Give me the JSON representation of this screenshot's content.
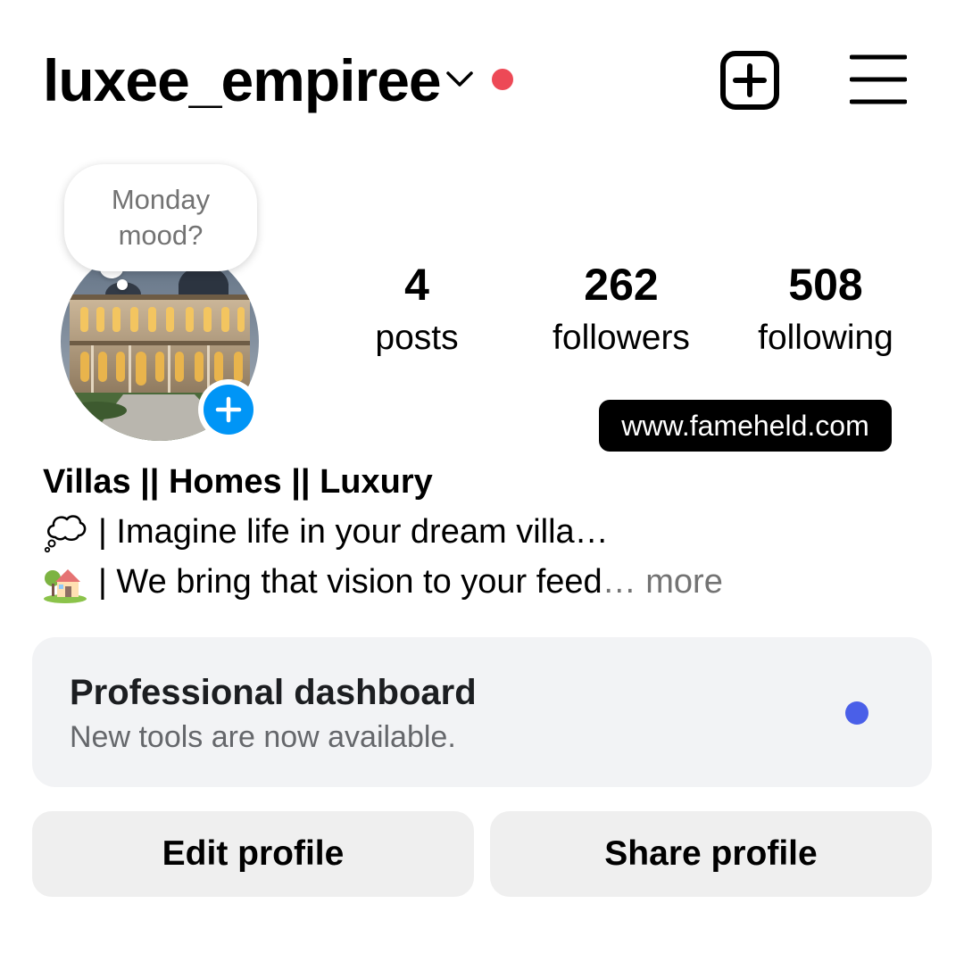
{
  "header": {
    "username": "luxee_empiree",
    "switch_account_icon": "chevron-down-icon",
    "notification_dot_color": "#ed4956",
    "new_post_icon": "plus-square-icon",
    "menu_icon": "hamburger-menu-icon"
  },
  "profile": {
    "note_text": "Monday mood?",
    "avatar_description": "profile-picture",
    "add_story_color": "#0095f6",
    "stats": [
      {
        "value": "4",
        "label": "posts"
      },
      {
        "value": "262",
        "label": "followers"
      },
      {
        "value": "508",
        "label": "following"
      }
    ],
    "link": "www.fameheld.com"
  },
  "bio": {
    "name": "Villas || Homes || Luxury",
    "line1": " | Imagine life in your dream villa…",
    "line1_icon": "thought-bubble-icon",
    "line2": " | We bring that vision to your feed",
    "line2_icon": "house-with-garden-icon",
    "more_label": "… more"
  },
  "dashboard": {
    "title": "Professional dashboard",
    "subtitle": "New tools are now available.",
    "dot_color": "#4a5fe8"
  },
  "actions": {
    "edit_label": "Edit profile",
    "share_label": "Share profile"
  }
}
